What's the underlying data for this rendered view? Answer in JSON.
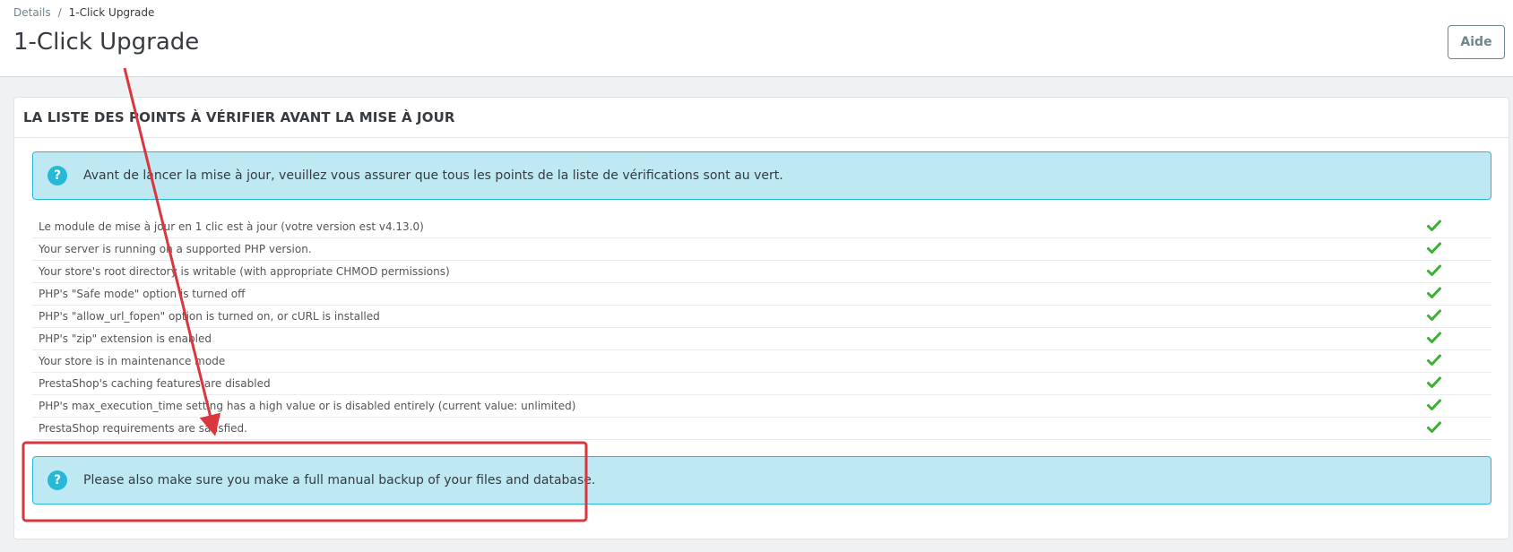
{
  "breadcrumb": {
    "parent": "Details",
    "separator": "/",
    "current": "1-Click Upgrade"
  },
  "page": {
    "title": "1-Click Upgrade",
    "help_label": "Aide"
  },
  "panel": {
    "heading": "LA LISTE DES POINTS À VÉRIFIER AVANT LA MISE À JOUR",
    "info_alert": "Avant de lancer la mise à jour, veuillez vous assurer que tous les points de la liste de vérifications sont au vert.",
    "items": [
      {
        "label": "Le module de mise à jour en 1 clic est à jour (votre version est v4.13.0)",
        "status": "ok"
      },
      {
        "label": "Your server is running on a supported PHP version.",
        "status": "ok"
      },
      {
        "label": "Your store's root directory is writable (with appropriate CHMOD permissions)",
        "status": "ok"
      },
      {
        "label": "PHP's \"Safe mode\" option is turned off",
        "status": "ok"
      },
      {
        "label": "PHP's \"allow_url_fopen\" option is turned on, or cURL is installed",
        "status": "ok"
      },
      {
        "label": "PHP's \"zip\" extension is enabled",
        "status": "ok"
      },
      {
        "label": "Your store is in maintenance mode",
        "status": "ok"
      },
      {
        "label": "PrestaShop's caching features are disabled",
        "status": "ok"
      },
      {
        "label": "PHP's max_execution_time setting has a high value or is disabled entirely (current value: unlimited)",
        "status": "ok"
      },
      {
        "label": "PrestaShop requirements are satisfied.",
        "status": "ok"
      }
    ],
    "backup_alert": "Please also make sure you make a full manual backup of your files and database."
  },
  "icons": {
    "alert": "question-circle-icon",
    "status_ok": "check-icon"
  },
  "colors": {
    "alert_bg": "#bee9f3",
    "alert_border": "#25b9d7",
    "check": "#3cb035",
    "annotation": "#d9363e"
  }
}
